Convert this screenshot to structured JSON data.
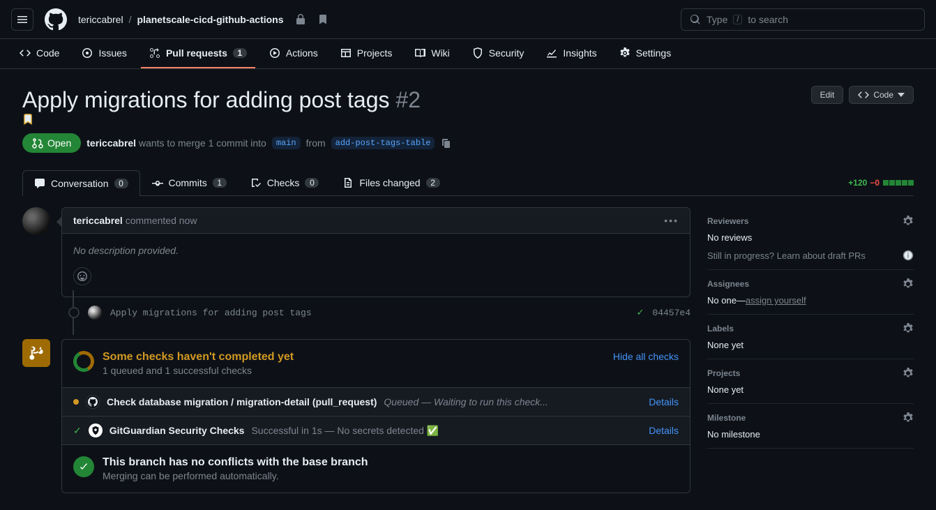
{
  "header": {
    "owner": "tericcabrel",
    "repo": "planetscale-cicd-github-actions",
    "search_prefix": "Type",
    "search_key": "/",
    "search_suffix": "to search"
  },
  "repo_nav": {
    "code": "Code",
    "issues": "Issues",
    "pulls": "Pull requests",
    "pulls_count": "1",
    "actions": "Actions",
    "projects": "Projects",
    "wiki": "Wiki",
    "security": "Security",
    "insights": "Insights",
    "settings": "Settings"
  },
  "pr": {
    "title": "Apply migrations for adding post tags",
    "number": "#2",
    "edit": "Edit",
    "code_btn": "Code",
    "state": "Open",
    "author": "tericcabrel",
    "merge_phrase_1": "wants to merge 1 commit into",
    "base": "main",
    "from": "from",
    "head": "add-post-tags-table"
  },
  "tabs": {
    "conversation": "Conversation",
    "conversation_count": "0",
    "commits": "Commits",
    "commits_count": "1",
    "checks": "Checks",
    "checks_count": "0",
    "files": "Files changed",
    "files_count": "2",
    "additions": "+120",
    "deletions": "−0"
  },
  "comment": {
    "author": "tericcabrel",
    "action": "commented",
    "time": "now",
    "body": "No description provided."
  },
  "commit": {
    "message": "Apply migrations for adding post tags",
    "sha": "04457e4"
  },
  "merge": {
    "checks_title": "Some checks haven't completed yet",
    "checks_sub": "1 queued and 1 successful checks",
    "hide": "Hide all checks",
    "row1_name": "Check database migration / migration-detail (pull_request)",
    "row1_status": "Queued — Waiting to run this check...",
    "row2_name": "GitGuardian Security Checks",
    "row2_status": "Successful in 1s — No secrets detected ✅",
    "details": "Details",
    "conflict_title": "This branch has no conflicts with the base branch",
    "conflict_sub": "Merging can be performed automatically."
  },
  "sidebar": {
    "reviewers": "Reviewers",
    "reviewers_text": "No reviews",
    "draft_q": "Still in progress?",
    "draft_link": "Learn about draft PRs",
    "assignees": "Assignees",
    "assignees_text": "No one—",
    "assign_self": "assign yourself",
    "labels": "Labels",
    "labels_text": "None yet",
    "projects": "Projects",
    "projects_text": "None yet",
    "milestone": "Milestone",
    "milestone_text": "No milestone"
  }
}
